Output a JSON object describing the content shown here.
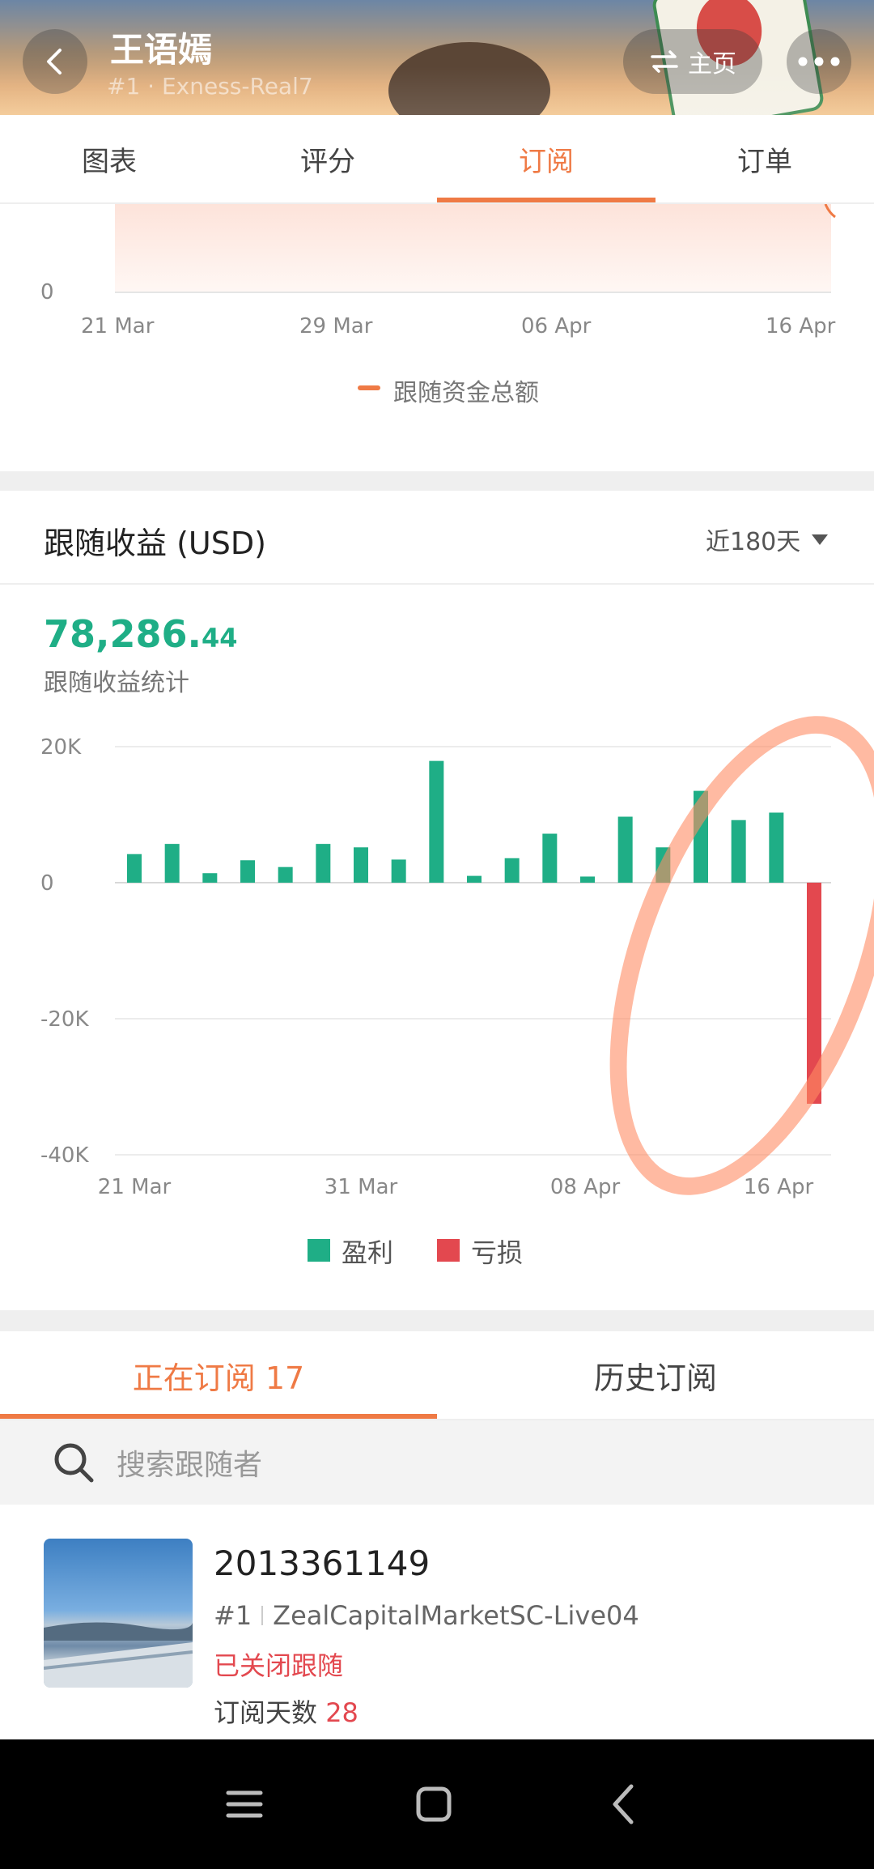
{
  "header": {
    "title": "王语嫣",
    "subtitle": "#1 · Exness-Real7",
    "home_label": "主页"
  },
  "tabs": [
    {
      "label": "图表",
      "active": false
    },
    {
      "label": "评分",
      "active": false
    },
    {
      "label": "订阅",
      "active": true
    },
    {
      "label": "订单",
      "active": false
    }
  ],
  "funds_chart": {
    "y_zero_label": "0",
    "x_labels": [
      "21 Mar",
      "29 Mar",
      "06 Apr",
      "16 Apr"
    ],
    "legend": "跟随资金总额",
    "legend_color": "#ef7a45"
  },
  "profit_section": {
    "title": "跟随收益 (USD)",
    "period": "近180天",
    "total_int": "78,286.",
    "total_dec": "44",
    "total_label": "跟随收益统计"
  },
  "chart_data": {
    "type": "bar",
    "y_ticks": [
      "20K",
      "0",
      "-20K",
      "-40K"
    ],
    "ylim": [
      -40000,
      20000
    ],
    "x_labels": [
      "21 Mar",
      "31 Mar",
      "08 Apr",
      "16 Apr"
    ],
    "values": [
      4200,
      5700,
      1400,
      3300,
      2300,
      5700,
      5200,
      3400,
      17900,
      1000,
      3600,
      7200,
      900,
      9700,
      5200,
      13500,
      9200,
      10300,
      -32500
    ],
    "legend": [
      {
        "label": "盈利",
        "color": "#1fae86"
      },
      {
        "label": "亏损",
        "color": "#e3484f"
      }
    ]
  },
  "subtabs": [
    {
      "label": "正在订阅 17",
      "active": true
    },
    {
      "label": "历史订阅",
      "active": false
    }
  ],
  "search": {
    "placeholder": "搜索跟随者"
  },
  "follower": {
    "id": "2013361149",
    "rank": "#1",
    "server": "ZealCapitalMarketSC-Live04",
    "status": "已关闭跟随",
    "days_label": "订阅天数",
    "days": "28"
  },
  "nav_icons": [
    "menu-icon",
    "home-square-icon",
    "back-chevron-icon"
  ]
}
